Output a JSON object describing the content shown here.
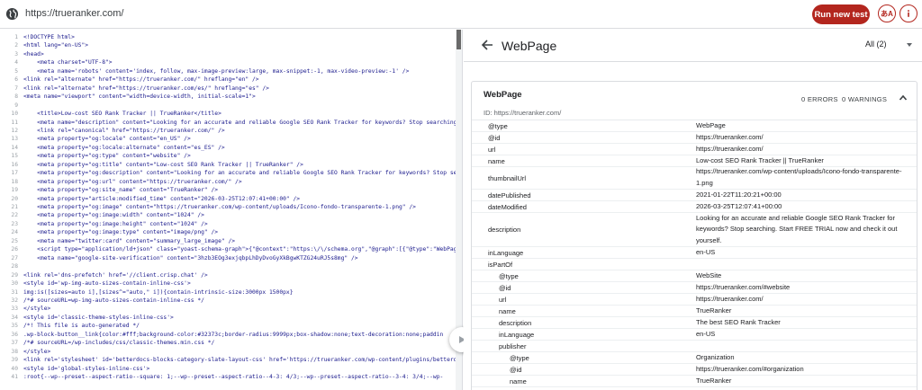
{
  "browser": {
    "url": "https://trueranker.com/",
    "run_button": "Run new test",
    "icon_ab_label": "あA"
  },
  "code": {
    "lines": [
      {
        "n": "1",
        "t": "<!DOCTYPE html>"
      },
      {
        "n": "2",
        "t": "<html lang=\"en-US\">"
      },
      {
        "n": "3",
        "t": "<head>"
      },
      {
        "n": "4",
        "t": "    <meta charset=\"UTF-8\">"
      },
      {
        "n": "5",
        "t": "    <meta name='robots' content='index, follow, max-image-preview:large, max-snippet:-1, max-video-preview:-1' />"
      },
      {
        "n": "6",
        "t": "<link rel=\"alternate\" href=\"https://trueranker.com/\" hreflang=\"en\" />"
      },
      {
        "n": "7",
        "t": "<link rel=\"alternate\" href=\"https://trueranker.com/es/\" hreflang=\"es\" />"
      },
      {
        "n": "8",
        "t": "<meta name=\"viewport\" content=\"width=device-width, initial-scale=1\">"
      },
      {
        "n": "9",
        "t": ""
      },
      {
        "n": "10",
        "t": "    <title>Low-cost SEO Rank Tracker || TrueRanker</title>"
      },
      {
        "n": "11",
        "t": "    <meta name=\"description\" content=\"Looking for an accurate and reliable Google SEO Rank Tracker for keywords? Stop searching"
      },
      {
        "n": "12",
        "t": "    <link rel=\"canonical\" href=\"https://trueranker.com/\" />"
      },
      {
        "n": "13",
        "t": "    <meta property=\"og:locale\" content=\"en_US\" />"
      },
      {
        "n": "14",
        "t": "    <meta property=\"og:locale:alternate\" content=\"es_ES\" />"
      },
      {
        "n": "15",
        "t": "    <meta property=\"og:type\" content=\"website\" />"
      },
      {
        "n": "16",
        "t": "    <meta property=\"og:title\" content=\"Low-cost SEO Rank Tracker || TrueRanker\" />"
      },
      {
        "n": "17",
        "t": "    <meta property=\"og:description\" content=\"Looking for an accurate and reliable Google SEO Rank Tracker for keywords? Stop se"
      },
      {
        "n": "18",
        "t": "    <meta property=\"og:url\" content=\"https://trueranker.com/\" />"
      },
      {
        "n": "19",
        "t": "    <meta property=\"og:site_name\" content=\"TrueRanker\" />"
      },
      {
        "n": "20",
        "t": "    <meta property=\"article:modified_time\" content=\"2026-03-25T12:07:41+00:00\" />"
      },
      {
        "n": "21",
        "t": "    <meta property=\"og:image\" content=\"https://trueranker.com/wp-content/uploads/Icono-fondo-transparente-1.png\" />"
      },
      {
        "n": "22",
        "t": "    <meta property=\"og:image:width\" content=\"1024\" />"
      },
      {
        "n": "23",
        "t": "    <meta property=\"og:image:height\" content=\"1024\" />"
      },
      {
        "n": "24",
        "t": "    <meta property=\"og:image:type\" content=\"image/png\" />"
      },
      {
        "n": "25",
        "t": "    <meta name=\"twitter:card\" content=\"summary_large_image\" />"
      },
      {
        "n": "26",
        "t": "    <script type=\"application/ld+json\" class=\"yoast-schema-graph\">{\"@context\":\"https:\\/\\/schema.org\",\"@graph\":[{\"@type\":\"WebPag"
      },
      {
        "n": "27",
        "t": "    <meta name=\"google-site-verification\" content=\"3hzb3EOg3exjqbpLhDyDvoGyXkBgwKTZG24uRJ5s8mg\" />"
      },
      {
        "n": "28",
        "t": ""
      },
      {
        "n": "29",
        "t": "<link rel='dns-prefetch' href='//client.crisp.chat' />"
      },
      {
        "n": "30",
        "t": "<style id='wp-img-auto-sizes-contain-inline-css'>"
      },
      {
        "n": "31",
        "t": "img:is([sizes=auto i],[sizes^=\"auto,\" i]){contain-intrinsic-size:3000px 1500px}"
      },
      {
        "n": "32",
        "t": "/*# sourceURL=wp-img-auto-sizes-contain-inline-css */"
      },
      {
        "n": "33",
        "t": "</style>"
      },
      {
        "n": "34",
        "t": "<style id='classic-theme-styles-inline-css'>"
      },
      {
        "n": "35",
        "t": "/*! This file is auto-generated */"
      },
      {
        "n": "36",
        "t": ".wp-block-button__link{color:#fff;background-color:#32373c;border-radius:9999px;box-shadow:none;text-decoration:none;paddin"
      },
      {
        "n": "37",
        "t": "/*# sourceURL=/wp-includes/css/classic-themes.min.css */"
      },
      {
        "n": "38",
        "t": "</style>"
      },
      {
        "n": "39",
        "t": "<link rel='stylesheet' id='betterdocs-blocks-category-slate-layout-css' href='https://trueranker.com/wp-content/plugins/betterd"
      },
      {
        "n": "40",
        "t": "<style id='global-styles-inline-css'>"
      },
      {
        "n": "41",
        "t": ":root{--wp--preset--aspect-ratio--square: 1;--wp--preset--aspect-ratio--4-3: 4/3;--wp--preset--aspect-ratio--3-4: 3/4;--wp-"
      }
    ]
  },
  "panel": {
    "title": "WebPage",
    "filter_label": "All (2)",
    "card": {
      "title": "WebPage",
      "errors": "0 ERRORS",
      "warnings": "0 WARNINGS",
      "id_line": "ID: https://trueranker.com/",
      "rows": [
        {
          "k": "@type",
          "v": "WebPage",
          "level": 0
        },
        {
          "k": "@id",
          "v": "https://trueranker.com/",
          "level": 0
        },
        {
          "k": "url",
          "v": "https://trueranker.com/",
          "level": 0
        },
        {
          "k": "name",
          "v": "Low-cost SEO Rank Tracker || TrueRanker",
          "level": 0
        },
        {
          "k": "thumbnailUrl",
          "v": "https://trueranker.com/wp-content/uploads/Icono-fondo-transparente-1.png",
          "level": 0
        },
        {
          "k": "datePublished",
          "v": "2021-01-22T11:20:21+00:00",
          "level": 0
        },
        {
          "k": "dateModified",
          "v": "2026-03-25T12:07:41+00:00",
          "level": 0
        },
        {
          "k": "description",
          "v": "Looking for an accurate and reliable Google SEO Rank Tracker for keywords? Stop searching. Start FREE TRIAL now and check it out yourself.",
          "level": 0
        },
        {
          "k": "inLanguage",
          "v": "en-US",
          "level": 0
        },
        {
          "k": "isPartOf",
          "v": "",
          "level": 0
        },
        {
          "k": "@type",
          "v": "WebSite",
          "level": 1
        },
        {
          "k": "@id",
          "v": "https://trueranker.com/#website",
          "level": 1
        },
        {
          "k": "url",
          "v": "https://trueranker.com/",
          "level": 1
        },
        {
          "k": "name",
          "v": "TrueRanker",
          "level": 1
        },
        {
          "k": "description",
          "v": "The best SEO Rank Tracker",
          "level": 1
        },
        {
          "k": "inLanguage",
          "v": "en-US",
          "level": 1
        },
        {
          "k": "publisher",
          "v": "",
          "level": 1
        },
        {
          "k": "@type",
          "v": "Organization",
          "level": 2
        },
        {
          "k": "@id",
          "v": "https://trueranker.com/#organization",
          "level": 2
        },
        {
          "k": "name",
          "v": "TrueRanker",
          "level": 2
        }
      ]
    }
  }
}
